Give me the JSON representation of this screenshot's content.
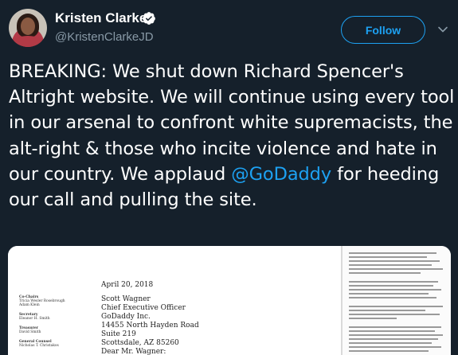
{
  "user": {
    "display_name": "Kristen Clarke",
    "handle": "@KristenClarkeJD",
    "verified": true
  },
  "actions": {
    "follow_label": "Follow"
  },
  "tweet": {
    "text_before_mention": "BREAKING: We shut down Richard Spencer's Altright website. We will continue using every tool in our arsenal to confront white supremacists, the alt-right & those who incite violence and hate in our country. We applaud ",
    "mention": "@GoDaddy",
    "text_after_mention": " for heeding our call and pulling the site."
  },
  "attachment": {
    "date": "April 20, 2018",
    "address_lines": [
      "Scott Wagner",
      "Chief Executive Officer",
      "GoDaddy Inc.",
      "14455 North Hayden Road",
      "Suite 219",
      "Scottsdale, AZ 85260"
    ],
    "greeting": "Dear Mr. Wagner:",
    "sidebar": [
      {
        "label": "Co-Chairs",
        "bold": true
      },
      {
        "label": "Tricia Wesler Rosebrough",
        "bold": false
      },
      {
        "label": "Adam Klein",
        "bold": false
      },
      {
        "label": "Secretary",
        "bold": true
      },
      {
        "label": "Eleanor H. Smith",
        "bold": false
      },
      {
        "label": "Treasurer",
        "bold": true
      },
      {
        "label": "David Smith",
        "bold": false
      },
      {
        "label": "General Counsel",
        "bold": true
      },
      {
        "label": "Nicholas T. Christakos",
        "bold": false
      }
    ]
  },
  "colors": {
    "background": "#15202b",
    "accent": "#1da1f2",
    "secondary_text": "#8899a6"
  }
}
